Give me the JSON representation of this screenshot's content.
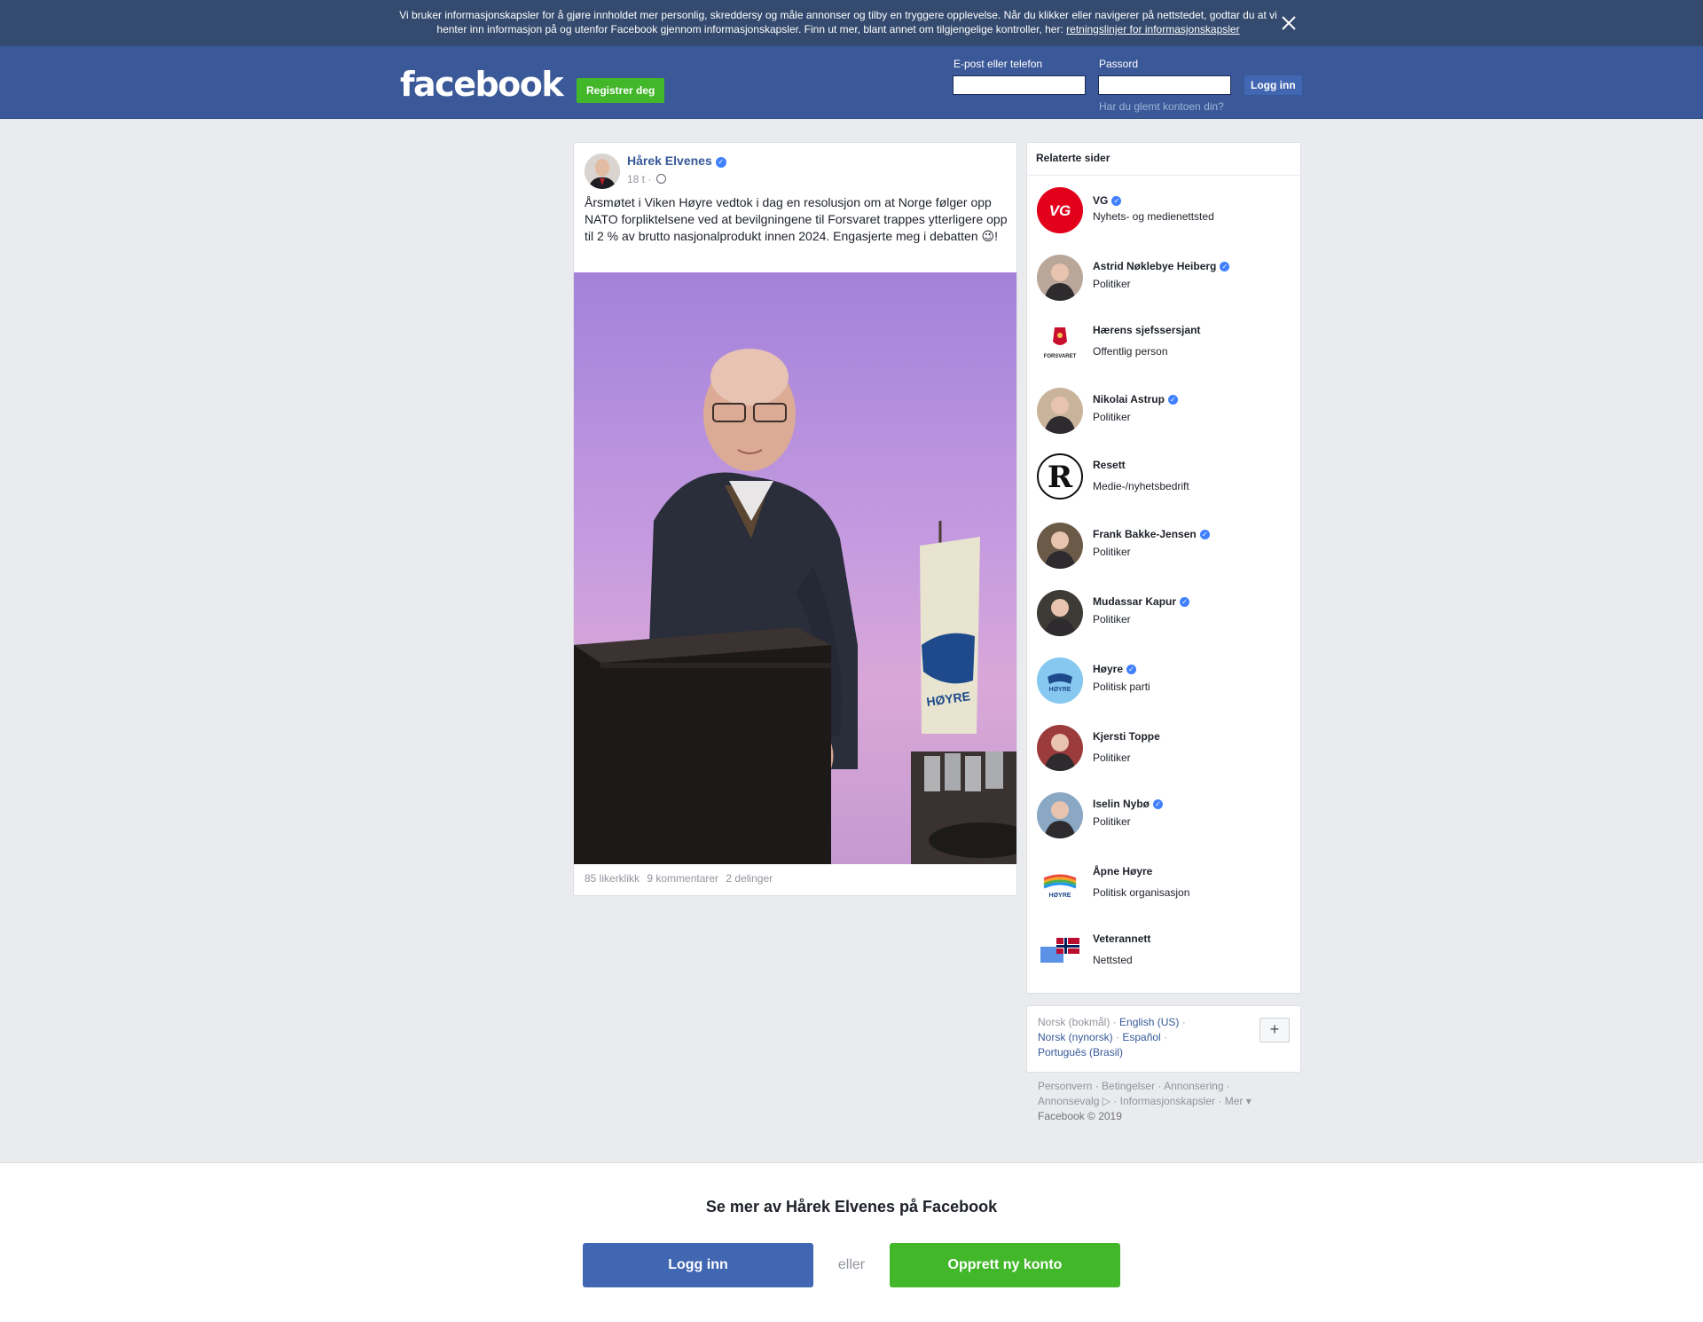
{
  "cookie_banner": {
    "text": "Vi bruker informasjonskapsler for å gjøre innholdet mer personlig, skreddersy og måle annonser og tilby en tryggere opplevelse. Når du klikker eller navigerer på nettstedet, godtar du at vi henter inn informasjon på og utenfor Facebook gjennom informasjonskapsler. Finn ut mer, blant annet om tilgjengelige kontroller, her: ",
    "link": "retningslinjer for informasjonskapsler",
    "close_icon": "close-icon"
  },
  "header": {
    "logo": "facebook",
    "register_label": "Registrer deg",
    "email_label": "E-post eller telefon",
    "password_label": "Passord",
    "email_value": "",
    "password_value": "",
    "login_label": "Logg inn",
    "forgot_label": "Har du glemt kontoen din?",
    "brand_color": "#3b5998"
  },
  "post": {
    "author": "Hårek Elvenes",
    "verified": true,
    "time": "18 t ·",
    "privacy_icon": "globe-icon",
    "text": "Årsmøtet i Viken Høyre vedtok i dag en resolusjon om at Norge følger opp NATO forpliktelsene ved at bevilgningene til Forsvaret trappes ytterligere opp til 2 % av brutto nasjonalprodukt innen 2024. Engasjerte meg i debatten 😉!",
    "photo_flag_text": "HØYRE",
    "likes": "85 likerklikk",
    "comments": "9 kommentarer",
    "shares": "2 delinger"
  },
  "related": {
    "title": "Relaterte sider",
    "items": [
      {
        "name": "VG",
        "verified": true,
        "category": "Nyhets- og medienettsted",
        "pic_text": "VG",
        "color": "#e3001b"
      },
      {
        "name": "Astrid Nøklebye Heiberg",
        "verified": true,
        "category": "Politiker",
        "color": "#b9a79a"
      },
      {
        "name": "Hærens sjefssersjant",
        "verified": false,
        "category": "Offentlig person",
        "pic_text": "FORSVARET",
        "color": "#c8102e"
      },
      {
        "name": "Nikolai Astrup",
        "verified": true,
        "category": "Politiker",
        "color": "#c9b49b"
      },
      {
        "name": "Resett",
        "verified": false,
        "category": "Medie-/nyhetsbedrift",
        "pic_text": "R",
        "color": "#111111"
      },
      {
        "name": "Frank Bakke-Jensen",
        "verified": true,
        "category": "Politiker",
        "color": "#6b5a48"
      },
      {
        "name": "Mudassar Kapur",
        "verified": true,
        "category": "Politiker",
        "color": "#3e3a36"
      },
      {
        "name": "Høyre",
        "verified": true,
        "category": "Politisk parti",
        "pic_text": "HØYRE",
        "color": "#87c8f0"
      },
      {
        "name": "Kjersti Toppe",
        "verified": false,
        "category": "Politiker",
        "color": "#9b3b3b"
      },
      {
        "name": "Iselin Nybø",
        "verified": true,
        "category": "Politiker",
        "color": "#8aa7c4"
      },
      {
        "name": "Åpne Høyre",
        "verified": false,
        "category": "Politisk organisasjon",
        "pic_text": "HØYRE",
        "color": "#e94b3c"
      },
      {
        "name": "Veterannett",
        "verified": false,
        "category": "Nettsted",
        "color": "#ba0c2f"
      }
    ]
  },
  "languages": {
    "current": "Norsk (bokmål)",
    "others": [
      "English (US)",
      "Norsk (nynorsk)",
      "Español",
      "Português (Brasil)"
    ],
    "plus_label": "+"
  },
  "footer": {
    "links": [
      "Personvern",
      "Betingelser",
      "Annonsering",
      "Annonsevalg",
      "Informasjonskapsler",
      "Mer"
    ],
    "copyright": "Facebook © 2019"
  },
  "bottom": {
    "title": "Se mer av Hårek Elvenes på Facebook",
    "login_label": "Logg inn",
    "or_label": "eller",
    "create_label": "Opprett ny konto"
  }
}
